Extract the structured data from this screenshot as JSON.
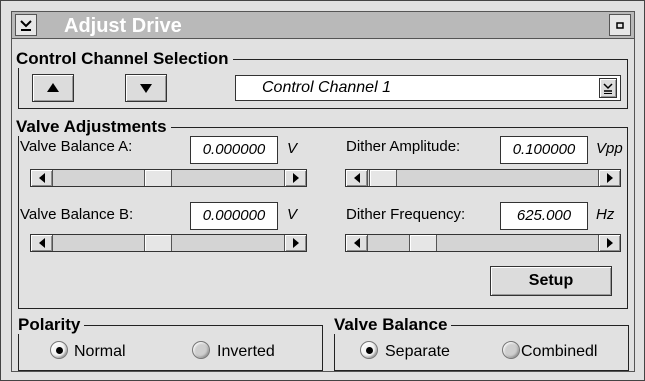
{
  "window": {
    "title": "Adjust Drive"
  },
  "control_channel": {
    "legend": "Control Channel Selection",
    "selected": "Control Channel 1"
  },
  "valve_adjustments": {
    "legend": "Valve Adjustments",
    "balance_a": {
      "label": "Valve Balance A:",
      "value": "0.000000",
      "unit": "V",
      "slider_fraction": 0.45
    },
    "balance_b": {
      "label": "Valve Balance B:",
      "value": "0.000000",
      "unit": "V",
      "slider_fraction": 0.45
    },
    "dither_amplitude": {
      "label": "Dither Amplitude:",
      "value": "0.100000",
      "unit": "Vpp",
      "slider_fraction": 0.0
    },
    "dither_frequency": {
      "label": "Dither Frequency:",
      "value": "625.000",
      "unit": "Hz",
      "slider_fraction": 0.2
    },
    "setup_label": "Setup"
  },
  "polarity": {
    "legend": "Polarity",
    "options": [
      {
        "label": "Normal",
        "selected": true
      },
      {
        "label": "Inverted",
        "selected": false
      }
    ]
  },
  "valve_balance": {
    "legend": "Valve Balance",
    "options": [
      {
        "label": "Separate",
        "selected": true
      },
      {
        "label": "Combinedl",
        "selected": false
      }
    ]
  }
}
